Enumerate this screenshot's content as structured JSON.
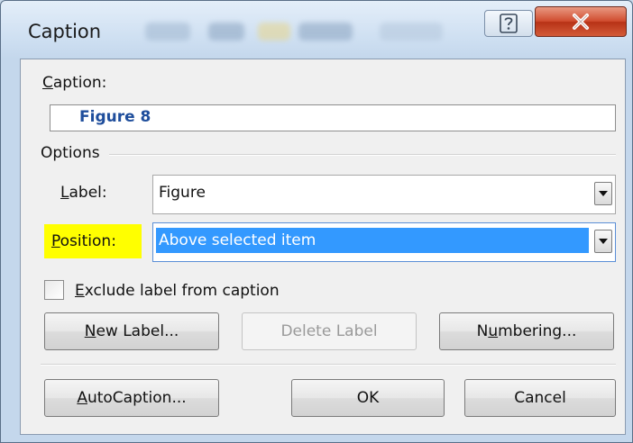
{
  "dialog": {
    "title": "Caption",
    "help_icon": "help-question-icon",
    "close_icon": "close-x-icon"
  },
  "caption": {
    "label_prefix": "C",
    "label_rest": "aption:",
    "value": "Figure 8"
  },
  "options": {
    "heading": "Options",
    "label_field": {
      "label_prefix": "L",
      "label_rest": "abel:",
      "value": "Figure"
    },
    "position_field": {
      "label_prefix": "P",
      "label_rest": "osition:",
      "value": "Above selected item"
    },
    "exclude_label": {
      "label_prefix": "E",
      "label_rest": "xclude label from caption",
      "checked": false
    }
  },
  "buttons": {
    "new_label_prefix": "N",
    "new_label_rest": "ew Label...",
    "delete_label": "Delete Label",
    "numbering_prefix": "N",
    "numbering_underlined": "u",
    "numbering_rest": "mbering...",
    "autocaption_prefix": "A",
    "autocaption_rest": "utoCaption...",
    "ok": "OK",
    "cancel": "Cancel"
  },
  "colors": {
    "caption_text": "#1f4e9c",
    "selection": "#3399ff",
    "highlight": "#ffff00",
    "close_button": "#c8412a"
  }
}
